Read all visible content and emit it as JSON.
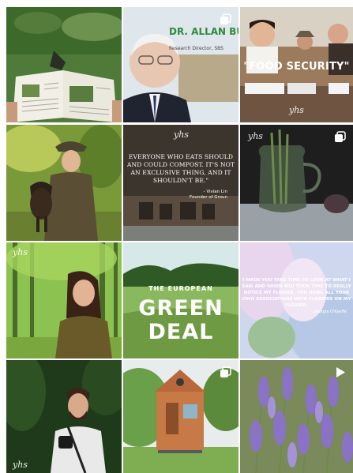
{
  "grid": {
    "tiles": [
      {
        "id": "newspaper",
        "overlay": {}
      },
      {
        "id": "dr-allan",
        "overlay": {
          "name": "DR. ALLAN BU",
          "role": "Research Director, SBS"
        },
        "badge": "multiple-photos-icon"
      },
      {
        "id": "food-security",
        "overlay": {
          "title": "\"FOOD SECURITY\"",
          "signature": "yhs"
        }
      },
      {
        "id": "hunter-dog",
        "overlay": {}
      },
      {
        "id": "compost-quote",
        "overlay": {
          "quote": "EVERYONE WHO EATS SHOULD AND COULD COMPOST. IT'S NOT AN EXCLUSIVE THING, AND IT SHOULDN'T BE.\"",
          "author": "- Vivian Lin",
          "author_role": "Founder of Groun",
          "signature": "yhs"
        }
      },
      {
        "id": "vase-still-life",
        "overlay": {
          "signature": "yhs"
        },
        "badge": "multiple-photos-icon"
      },
      {
        "id": "forest-woman",
        "overlay": {
          "signature": "yhs"
        }
      },
      {
        "id": "green-deal",
        "overlay": {
          "line1": "THE EUROPEAN",
          "line2": "GREEN",
          "line3": "DEAL"
        }
      },
      {
        "id": "okeeffe-quote",
        "overlay": {
          "quote": "I MADE YOU TAKE TIME TO LOOK AT WHAT I SAW AND WHEN YOU TOOK TIME TO REALLY NOTICE MY FLOWER, YOU HUNG ALL YOUR OWN ASSOCIATIONS WITH FLOWERS ON MY FLOWER.",
          "author": "- Georgia O'Keeffe"
        }
      },
      {
        "id": "bearded-man",
        "overlay": {
          "signature": "yhs"
        }
      },
      {
        "id": "tiny-house",
        "overlay": {},
        "badge": "multiple-photos-icon"
      },
      {
        "id": "lavender",
        "overlay": {},
        "badge": "reel-play-icon"
      }
    ]
  },
  "colors": {
    "background": "#ffffff",
    "overlay_text": "#ffffff",
    "green_deal_text": "#ffffff",
    "allan_name": "#2e8b3c"
  }
}
